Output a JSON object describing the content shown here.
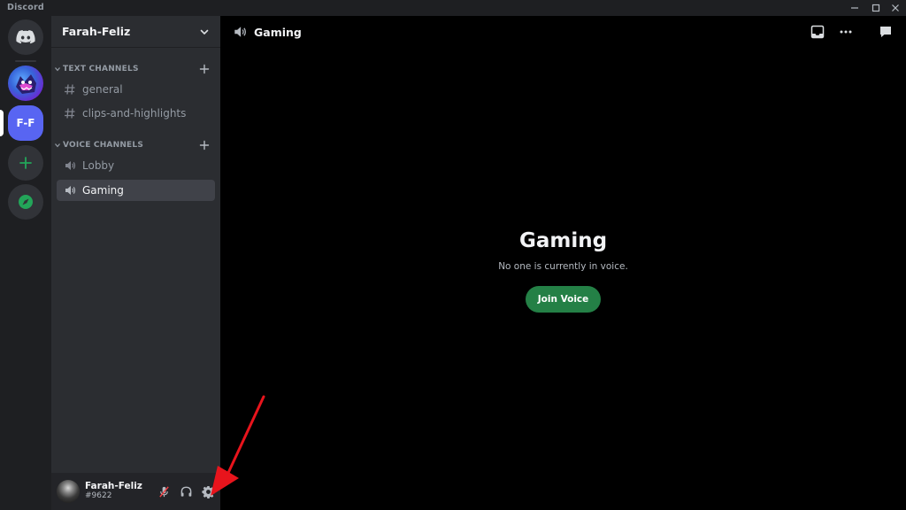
{
  "window": {
    "app_title": "Discord",
    "controls": [
      "minimize-icon",
      "maximize-icon",
      "close-icon"
    ]
  },
  "servers": {
    "home_icon": "discord-logo-icon",
    "items": [
      {
        "name": "mrbeast-server-icon"
      },
      {
        "name": "farah-feliz-server",
        "initials": "F-F",
        "selected": true
      }
    ],
    "add_icon": "plus-icon",
    "discover_icon": "compass-icon"
  },
  "sidebar": {
    "server_name": "Farah-Feliz",
    "categories": [
      {
        "label": "TEXT CHANNELS",
        "channels": [
          {
            "label": "general",
            "icon": "hash-icon"
          },
          {
            "label": "clips-and-highlights",
            "icon": "hash-icon"
          }
        ]
      },
      {
        "label": "VOICE CHANNELS",
        "channels": [
          {
            "label": "Lobby",
            "icon": "speaker-icon"
          },
          {
            "label": "Gaming",
            "icon": "speaker-icon",
            "active": true
          }
        ]
      }
    ]
  },
  "user": {
    "name": "Farah-Feliz",
    "tag": "#9622",
    "buttons": [
      "mic-muted-icon",
      "headphones-icon",
      "gear-icon"
    ]
  },
  "main": {
    "channel_title": "Gaming",
    "header_buttons": [
      "inbox-icon",
      "more-icon",
      "chat-icon"
    ],
    "voice_title": "Gaming",
    "voice_subtitle": "No one is currently in voice.",
    "join_label": "Join Voice"
  },
  "colors": {
    "accent": "#5865f2",
    "join_green": "#248046",
    "annotation_arrow": "#e8141c"
  }
}
